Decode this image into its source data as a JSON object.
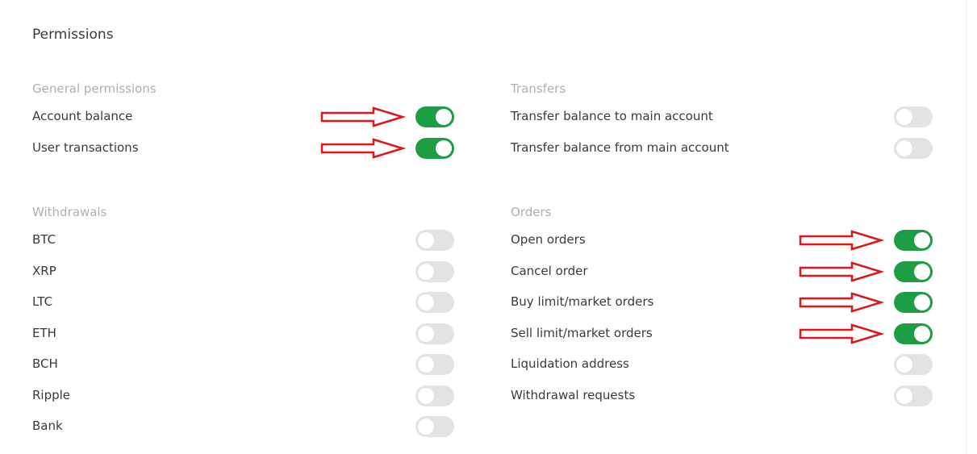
{
  "title": "Permissions",
  "sections": {
    "general": {
      "header": "General permissions",
      "items": [
        {
          "label": "Account balance",
          "enabled": true,
          "arrow": true
        },
        {
          "label": "User transactions",
          "enabled": true,
          "arrow": true
        }
      ]
    },
    "transfers": {
      "header": "Transfers",
      "items": [
        {
          "label": "Transfer balance to main account",
          "enabled": false,
          "arrow": false
        },
        {
          "label": "Transfer balance from main account",
          "enabled": false,
          "arrow": false
        }
      ]
    },
    "withdrawals": {
      "header": "Withdrawals",
      "items": [
        {
          "label": "BTC",
          "enabled": false,
          "arrow": false
        },
        {
          "label": "XRP",
          "enabled": false,
          "arrow": false
        },
        {
          "label": "LTC",
          "enabled": false,
          "arrow": false
        },
        {
          "label": "ETH",
          "enabled": false,
          "arrow": false
        },
        {
          "label": "BCH",
          "enabled": false,
          "arrow": false
        },
        {
          "label": "Ripple",
          "enabled": false,
          "arrow": false
        },
        {
          "label": "Bank",
          "enabled": false,
          "arrow": false
        }
      ]
    },
    "orders": {
      "header": "Orders",
      "items": [
        {
          "label": "Open orders",
          "enabled": true,
          "arrow": true
        },
        {
          "label": "Cancel order",
          "enabled": true,
          "arrow": true
        },
        {
          "label": "Buy limit/market orders",
          "enabled": true,
          "arrow": true
        },
        {
          "label": "Sell limit/market orders",
          "enabled": true,
          "arrow": true
        },
        {
          "label": "Liquidation address",
          "enabled": false,
          "arrow": false
        },
        {
          "label": "Withdrawal requests",
          "enabled": false,
          "arrow": false
        }
      ]
    }
  },
  "colors": {
    "toggle_on": "#1e9e44",
    "toggle_off": "#e3e3e3",
    "annotation_arrow": "#e0161b",
    "section_header": "#b0b0b0",
    "text": "#3a3a3a"
  },
  "icons": {
    "annotation": "red-right-arrow-icon"
  }
}
